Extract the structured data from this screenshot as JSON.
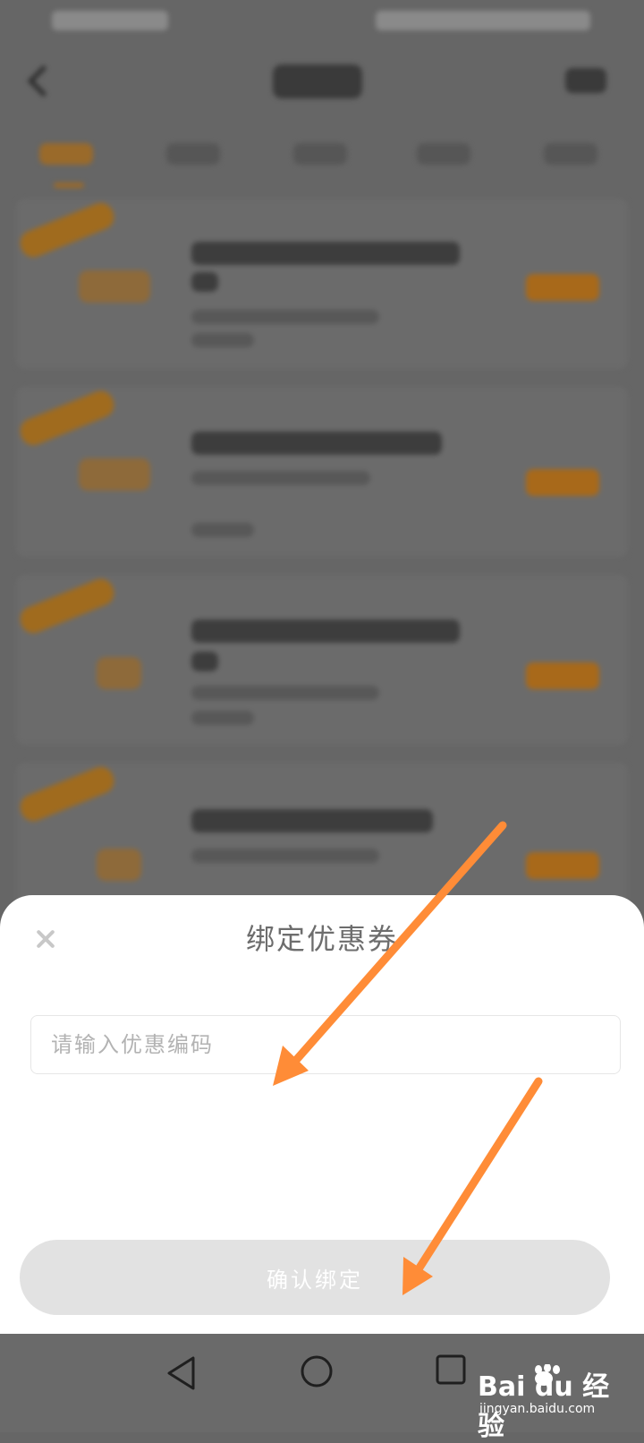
{
  "sheet": {
    "title": "绑定优惠券",
    "input_placeholder": "请输入优惠编码",
    "confirm_label": "确认绑定"
  },
  "background_page": {
    "blurred": true,
    "card_count": 4
  },
  "system_nav": {
    "icons": [
      "back-triangle-icon",
      "home-circle-icon",
      "recent-square-icon"
    ]
  },
  "watermark": {
    "brand": "Bai du 经验",
    "url": "jingyan.baidu.com"
  },
  "colors": {
    "annotation_arrow": "#ff8c37",
    "accent_blurred": "#a8691a",
    "button_disabled": "#e2e2e2"
  }
}
